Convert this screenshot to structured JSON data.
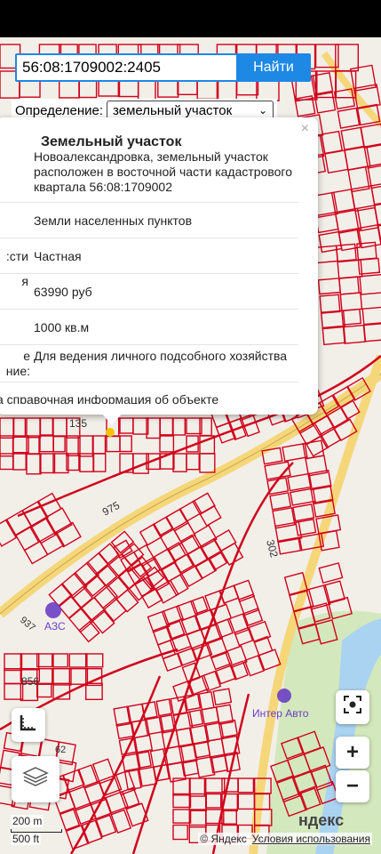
{
  "search": {
    "query": "56:08:1709002:2405",
    "button_label": "Найти"
  },
  "definition": {
    "label": "Определение:",
    "selected": "земельный участок",
    "chevron_icon": "chevron-down-icon"
  },
  "popup": {
    "title": "Земельный участок",
    "close_label": "×",
    "rows": [
      {
        "key": "",
        "value": "Новоалександровка, земельный участок расположен в восточной части кадастрового квартала 56:08:1709002"
      },
      {
        "key": "",
        "value": "Земли населенных пунктов"
      },
      {
        "key": "сти:",
        "value": "Частная"
      },
      {
        "key": "я",
        "value": "63990 руб"
      },
      {
        "key": "",
        "value": "1000 кв.м"
      },
      {
        "key": "е ние:",
        "value": "Для ведения личного подсобного хозяйства"
      }
    ],
    "footer": "а справочная информация об объекте"
  },
  "map": {
    "labels": [
      "135",
      "975",
      "302",
      "937",
      "856",
      "62",
      "АЗС",
      "Интер Авто"
    ],
    "colors": {
      "parcel": "#d0021b",
      "road": "#f5d77a",
      "water": "#aad3f2",
      "green": "#cbe6b0",
      "poi": "#6a3fc4"
    }
  },
  "controls": {
    "geolocate_icon": "geolocation-icon",
    "zoom_in_label": "+",
    "zoom_out_label": "−",
    "layers_icon": "layers-icon",
    "ruler_icon": "ruler-icon"
  },
  "scale": {
    "metric": "200 m",
    "imperial": "500 ft"
  },
  "attribution": {
    "copyright": "© Яндекс",
    "terms": "Условия использования",
    "logo": "ндекс"
  }
}
